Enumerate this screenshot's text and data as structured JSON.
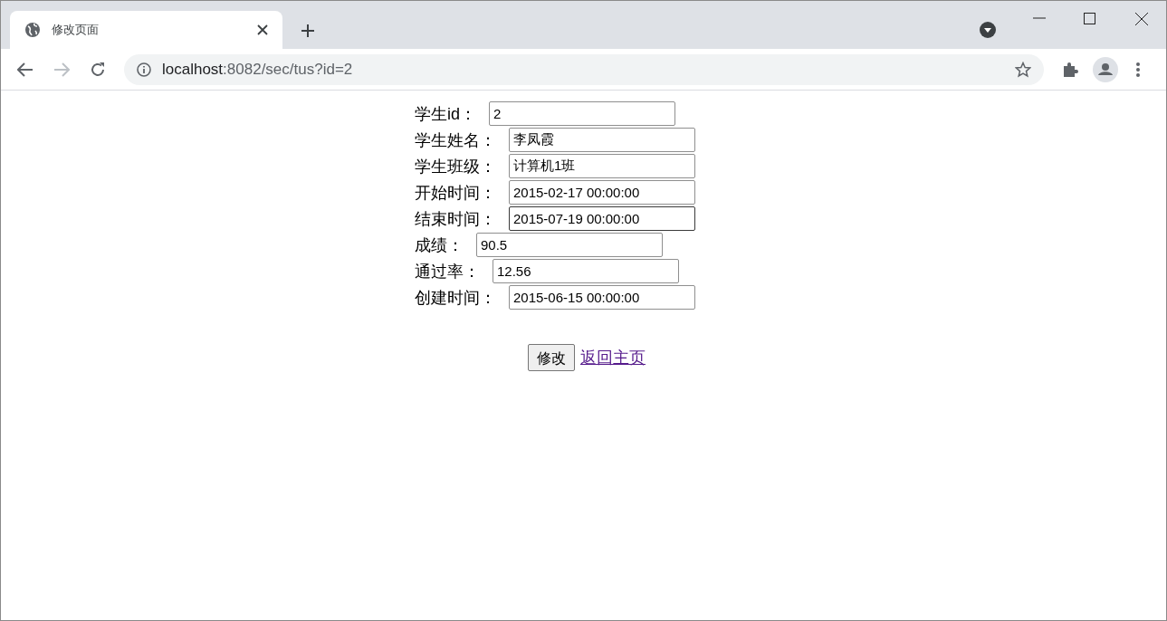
{
  "tab": {
    "title": "修改页面",
    "selected": true
  },
  "address_bar": {
    "host": "localhost",
    "path": ":8082/sec/tus?id=2"
  },
  "form": {
    "fields": [
      {
        "label": "学生id：",
        "value": "2",
        "focused": false
      },
      {
        "label": "学生姓名：",
        "value": "李凤霞",
        "focused": false
      },
      {
        "label": "学生班级：",
        "value": "计算机1班",
        "focused": false
      },
      {
        "label": "开始时间：",
        "value": "2015-02-17 00:00:00",
        "focused": false
      },
      {
        "label": "结束时间：",
        "value": "2015-07-19 00:00:00",
        "focused": true
      },
      {
        "label": "成绩：",
        "value": "90.5",
        "focused": false
      },
      {
        "label": "通过率：",
        "value": "12.56",
        "focused": false
      },
      {
        "label": "创建时间：",
        "value": "2015-06-15 00:00:00",
        "focused": false
      }
    ],
    "submit": "修改",
    "back_link": "返回主页"
  }
}
